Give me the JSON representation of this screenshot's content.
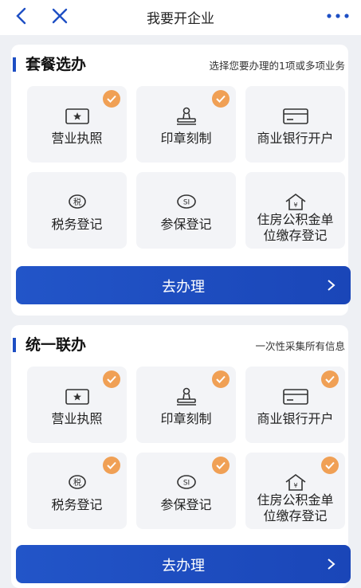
{
  "header": {
    "title": "我要开企业"
  },
  "sections": [
    {
      "title": "套餐选办",
      "hint": "选择您要办理的1项或多项业务",
      "tiles": [
        {
          "label": "营业执照",
          "checked": true,
          "icon": "license-icon"
        },
        {
          "label": "印章刻制",
          "checked": true,
          "icon": "stamp-icon"
        },
        {
          "label": "商业银行开户",
          "checked": false,
          "icon": "card-icon"
        },
        {
          "label": "税务登记",
          "checked": false,
          "icon": "tax-icon"
        },
        {
          "label": "参保登记",
          "checked": false,
          "icon": "social-insurance-icon"
        },
        {
          "label": "住房公积金单位缴存登记",
          "line1": "住房公积金单",
          "line2": "位缴存登记",
          "checked": false,
          "icon": "housing-fund-icon"
        }
      ],
      "button": "去办理"
    },
    {
      "title": "统一联办",
      "hint": "一次性采集所有信息",
      "tiles": [
        {
          "label": "营业执照",
          "checked": true,
          "icon": "license-icon"
        },
        {
          "label": "印章刻制",
          "checked": true,
          "icon": "stamp-icon"
        },
        {
          "label": "商业银行开户",
          "checked": true,
          "icon": "card-icon"
        },
        {
          "label": "税务登记",
          "checked": true,
          "icon": "tax-icon"
        },
        {
          "label": "参保登记",
          "checked": true,
          "icon": "social-insurance-icon"
        },
        {
          "label": "住房公积金单位缴存登记",
          "line1": "住房公积金单",
          "line2": "位缴存登记",
          "checked": true,
          "icon": "housing-fund-icon"
        }
      ],
      "button": "去办理"
    }
  ],
  "icon_glyphs": {
    "tax": "税",
    "social": "SI",
    "yuan": "¥"
  },
  "colors": {
    "accent": "#1e4fc4",
    "check": "#f0a055",
    "tile_bg": "#f3f4f7"
  }
}
